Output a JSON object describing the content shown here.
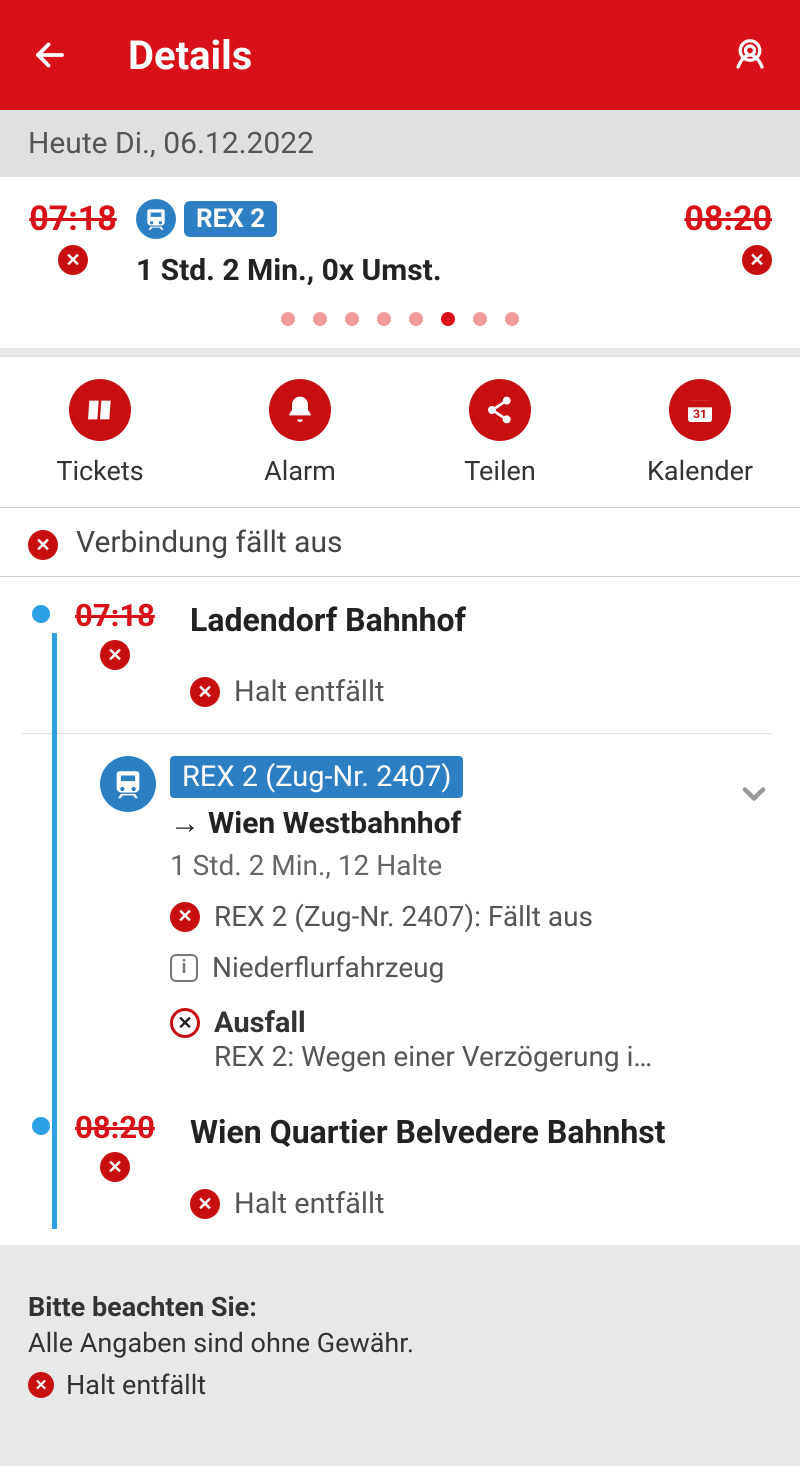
{
  "header": {
    "title": "Details"
  },
  "date_bar": "Heute Di., 06.12.2022",
  "summary": {
    "depart_time": "07:18",
    "arrive_time": "08:20",
    "line_label": "REX 2",
    "duration": "1 Std. 2 Min., 0x Umst.",
    "page_dots": {
      "count": 8,
      "active_index": 5
    }
  },
  "actions": {
    "tickets": "Tickets",
    "alarm": "Alarm",
    "share": "Teilen",
    "calendar": "Kalender"
  },
  "banner": "Verbindung fällt aus",
  "journey": {
    "start": {
      "time": "07:18",
      "station": "Ladendorf Bahnhof",
      "halt_status": "Halt entfällt"
    },
    "segment": {
      "chip": "REX 2 (Zug-Nr. 2407)",
      "destination": "Wien Westbahnhof",
      "meta": "1 Std. 2 Min., 12 Halte",
      "cancel_msg": "REX 2 (Zug-Nr. 2407): Fällt aus",
      "info_msg": "Niederflurfahrzeug",
      "ausfall_title": "Ausfall",
      "ausfall_msg": "REX 2: Wegen einer Verzögerung i…"
    },
    "end": {
      "time": "08:20",
      "station": "Wien Quartier Belvedere Bahnhst",
      "halt_status": "Halt entfällt"
    }
  },
  "footer": {
    "title": "Bitte beachten Sie:",
    "line1": "Alle Angaben sind ohne Gewähr.",
    "line2": "Halt entfällt"
  }
}
